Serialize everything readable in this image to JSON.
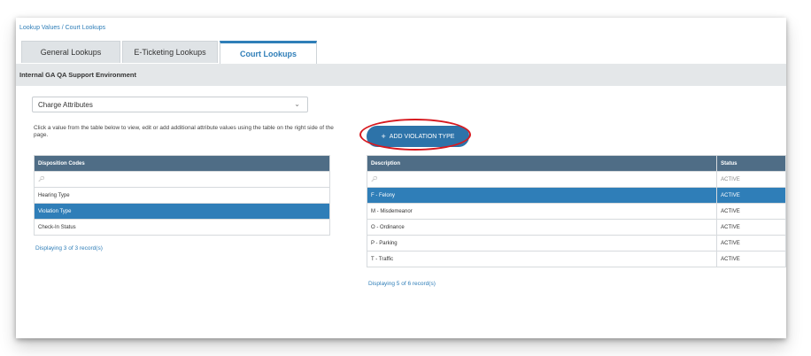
{
  "breadcrumb": "Lookup Values / Court Lookups",
  "tabs": {
    "general": "General Lookups",
    "eticketing": "E-Ticketing Lookups",
    "court": "Court Lookups"
  },
  "environment": "Internal GA QA Support Environment",
  "attribute_select": {
    "value": "Charge Attributes"
  },
  "instructions": "Click a value from the table below to view, edit or add additional attribute values using the table on the right side of the page.",
  "add_button": "ADD VIOLATION TYPE",
  "left_table": {
    "header": "Disposition Codes",
    "search_icon": "search-icon",
    "rows": [
      "Hearing Type",
      "Violation Type",
      "Check-In Status"
    ],
    "selected_index": 1,
    "count_text": "Displaying 3 of 3 record(s)"
  },
  "right_table": {
    "headers": {
      "description": "Description",
      "status": "Status"
    },
    "search_status": "ACTIVE",
    "rows": [
      {
        "description": "F - Felony",
        "status": "ACTIVE"
      },
      {
        "description": "M - Misdemeanor",
        "status": "ACTIVE"
      },
      {
        "description": "O - Ordinance",
        "status": "ACTIVE"
      },
      {
        "description": "P - Parking",
        "status": "ACTIVE"
      },
      {
        "description": "T - Traffic",
        "status": "ACTIVE"
      }
    ],
    "selected_index": 0,
    "count_text": "Displaying 5 of 6 record(s)"
  },
  "colors": {
    "accent": "#2f7eb8",
    "header": "#4f6d86",
    "button": "#2d73a9",
    "highlight_ring": "#d7191f"
  }
}
